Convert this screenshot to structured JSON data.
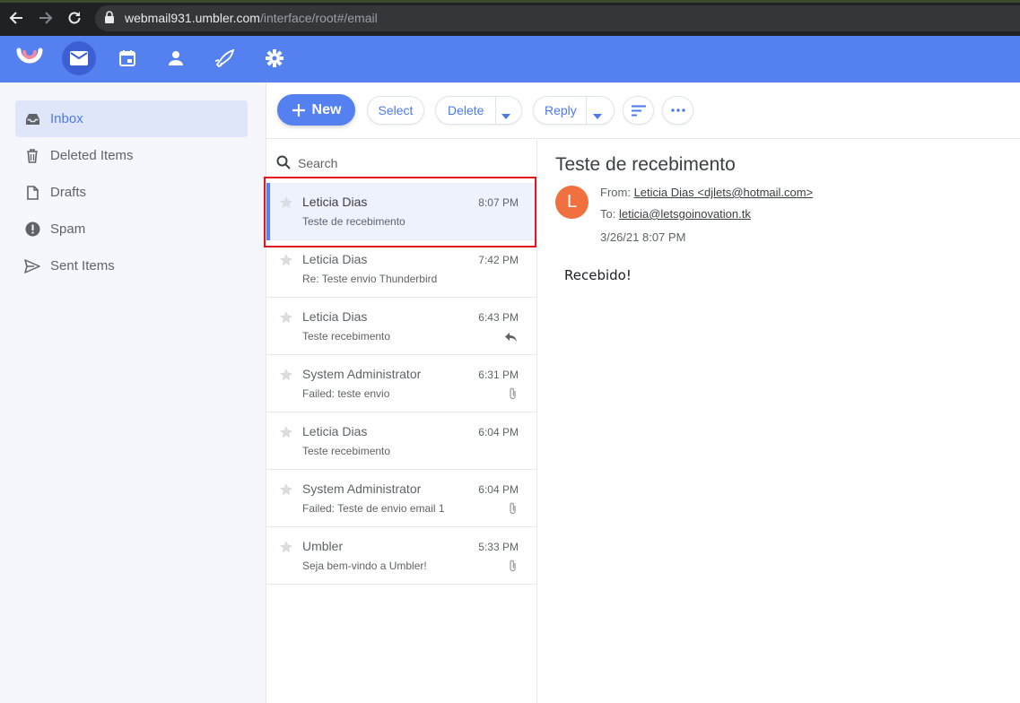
{
  "browser": {
    "url_host": "webmail931.umbler.com",
    "url_path": "/interface/root#/email"
  },
  "sidebar": {
    "items": [
      {
        "label": "Inbox",
        "icon": "inbox-icon"
      },
      {
        "label": "Deleted Items",
        "icon": "trash-icon"
      },
      {
        "label": "Drafts",
        "icon": "draft-icon"
      },
      {
        "label": "Spam",
        "icon": "spam-icon"
      },
      {
        "label": "Sent Items",
        "icon": "send-icon"
      }
    ]
  },
  "toolbar": {
    "new_label": "New",
    "select_label": "Select",
    "delete_label": "Delete",
    "reply_label": "Reply"
  },
  "list": {
    "search_placeholder": "Search",
    "messages": [
      {
        "sender": "Leticia Dias",
        "time": "8:07 PM",
        "subject": "Teste de recebimento",
        "flag": "",
        "selected": true
      },
      {
        "sender": "Leticia Dias",
        "time": "7:42 PM",
        "subject": "Re: Teste envio Thunderbird",
        "flag": ""
      },
      {
        "sender": "Leticia Dias",
        "time": "6:43 PM",
        "subject": "Teste recebimento",
        "flag": "reply-icon"
      },
      {
        "sender": "System Administrator",
        "time": "6:31 PM",
        "subject": "Failed: teste envio",
        "flag": "attachment-icon"
      },
      {
        "sender": "Leticia Dias",
        "time": "6:04 PM",
        "subject": "Teste recebimento",
        "flag": ""
      },
      {
        "sender": "System Administrator",
        "time": "6:04 PM",
        "subject": "Failed: Teste de envio email 1",
        "flag": "attachment-icon"
      },
      {
        "sender": "Umbler",
        "time": "5:33 PM",
        "subject": "Seja bem-vindo a Umbler!",
        "flag": "attachment-icon"
      }
    ]
  },
  "reader": {
    "title": "Teste de recebimento",
    "avatar_letter": "L",
    "avatar_color": "#f07040",
    "from_label": "From:",
    "from_value": "Leticia Dias <djlets@hotmail.com>",
    "to_label": "To:",
    "to_value": "leticia@letsgoinovation.tk",
    "date": "3/26/21 8:07 PM",
    "body": "Recebido!"
  },
  "colors": {
    "accent": "#5580f0",
    "highlight_box": "#e0171d"
  }
}
